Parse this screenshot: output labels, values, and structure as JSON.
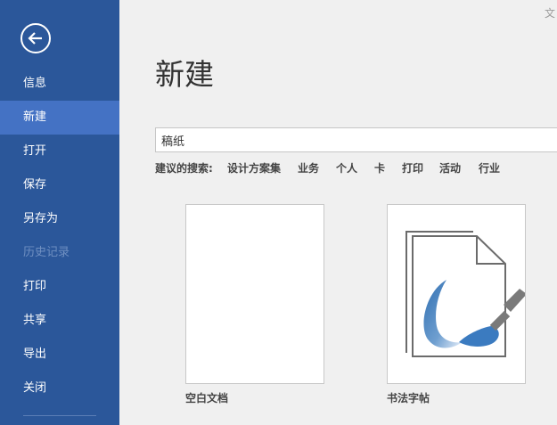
{
  "sidebar": {
    "items": [
      {
        "label": "信息"
      },
      {
        "label": "新建"
      },
      {
        "label": "打开"
      },
      {
        "label": "保存"
      },
      {
        "label": "另存为"
      },
      {
        "label": "历史记录"
      },
      {
        "label": "打印"
      },
      {
        "label": "共享"
      },
      {
        "label": "导出"
      },
      {
        "label": "关闭"
      }
    ],
    "active": "新建",
    "disabled": "历史记录"
  },
  "corner_text": "文",
  "page": {
    "title": "新建"
  },
  "search": {
    "value": "稿纸"
  },
  "suggestions": {
    "label": "建议的搜索:",
    "links": [
      "设计方案集",
      "业务",
      "个人",
      "卡",
      "打印",
      "活动",
      "行业"
    ]
  },
  "templates": [
    {
      "label": "空白文档"
    },
    {
      "label": "书法字帖"
    }
  ],
  "colors": {
    "sidebar": "#2b579a",
    "sidebar_active": "#4472c4",
    "background": "#f0f0f0"
  }
}
